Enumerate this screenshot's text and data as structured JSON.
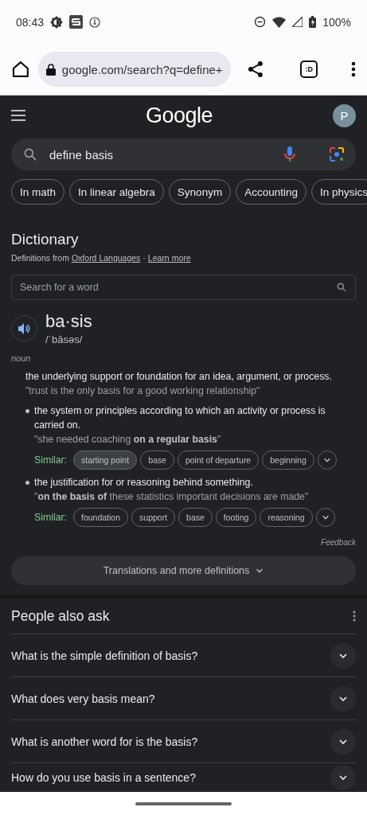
{
  "status_bar": {
    "time": "08:43",
    "battery": "100%"
  },
  "browser": {
    "url": "google.com/search?q=define+",
    "tab_switcher": ":D"
  },
  "header": {
    "logo": "Google",
    "avatar": "P"
  },
  "search": {
    "value": "define basis"
  },
  "chips": [
    {
      "label": "In math"
    },
    {
      "label": "In linear algebra"
    },
    {
      "label": "Synonym"
    },
    {
      "label": "Accounting"
    },
    {
      "label": "In physics"
    }
  ],
  "dictionary": {
    "title": "Dictionary",
    "source_prefix": "Definitions from",
    "source_link": "Oxford Languages",
    "separator": "·",
    "learn_more": "Learn more",
    "word_search": {
      "placeholder": "Search for a word"
    },
    "word": "ba·sis",
    "phonetic": "/ˈbāsəs/",
    "part_of_speech": "noun",
    "definitions": [
      {
        "kind": "main",
        "text": "the underlying support or foundation for an idea, argument, or process.",
        "example": "\"trust is the only basis for a good working relationship\""
      },
      {
        "kind": "sub",
        "text": "the system or principles according to which an activity or process is carried on.",
        "example": "\"she needed coaching **on a regular basis**\"",
        "similar_label": "Similar:",
        "similar": [
          {
            "label": "starting point",
            "selected": true
          },
          {
            "label": "base",
            "selected": false
          },
          {
            "label": "point of departure",
            "selected": false
          },
          {
            "label": "beginning",
            "selected": false
          }
        ]
      },
      {
        "kind": "sub",
        "text": "the justification for or reasoning behind something.",
        "example": "\"**on the basis of** these statistics important decisions are made\"",
        "similar_label": "Similar:",
        "similar": [
          {
            "label": "foundation",
            "selected": false
          },
          {
            "label": "support",
            "selected": false
          },
          {
            "label": "base",
            "selected": false
          },
          {
            "label": "footing",
            "selected": false
          },
          {
            "label": "reasoning",
            "selected": false
          }
        ]
      }
    ],
    "feedback": "Feedback",
    "more_button": "Translations and more definitions"
  },
  "people_also_ask": {
    "title": "People also ask",
    "questions": [
      {
        "text": "What is the simple definition of basis?",
        "expanded": false
      },
      {
        "text": "What does very basis mean?",
        "expanded": false
      },
      {
        "text": "What is another word for is the basis?",
        "expanded": false
      },
      {
        "text": "How do you use basis in a sentence?",
        "expanded": false
      }
    ]
  }
}
